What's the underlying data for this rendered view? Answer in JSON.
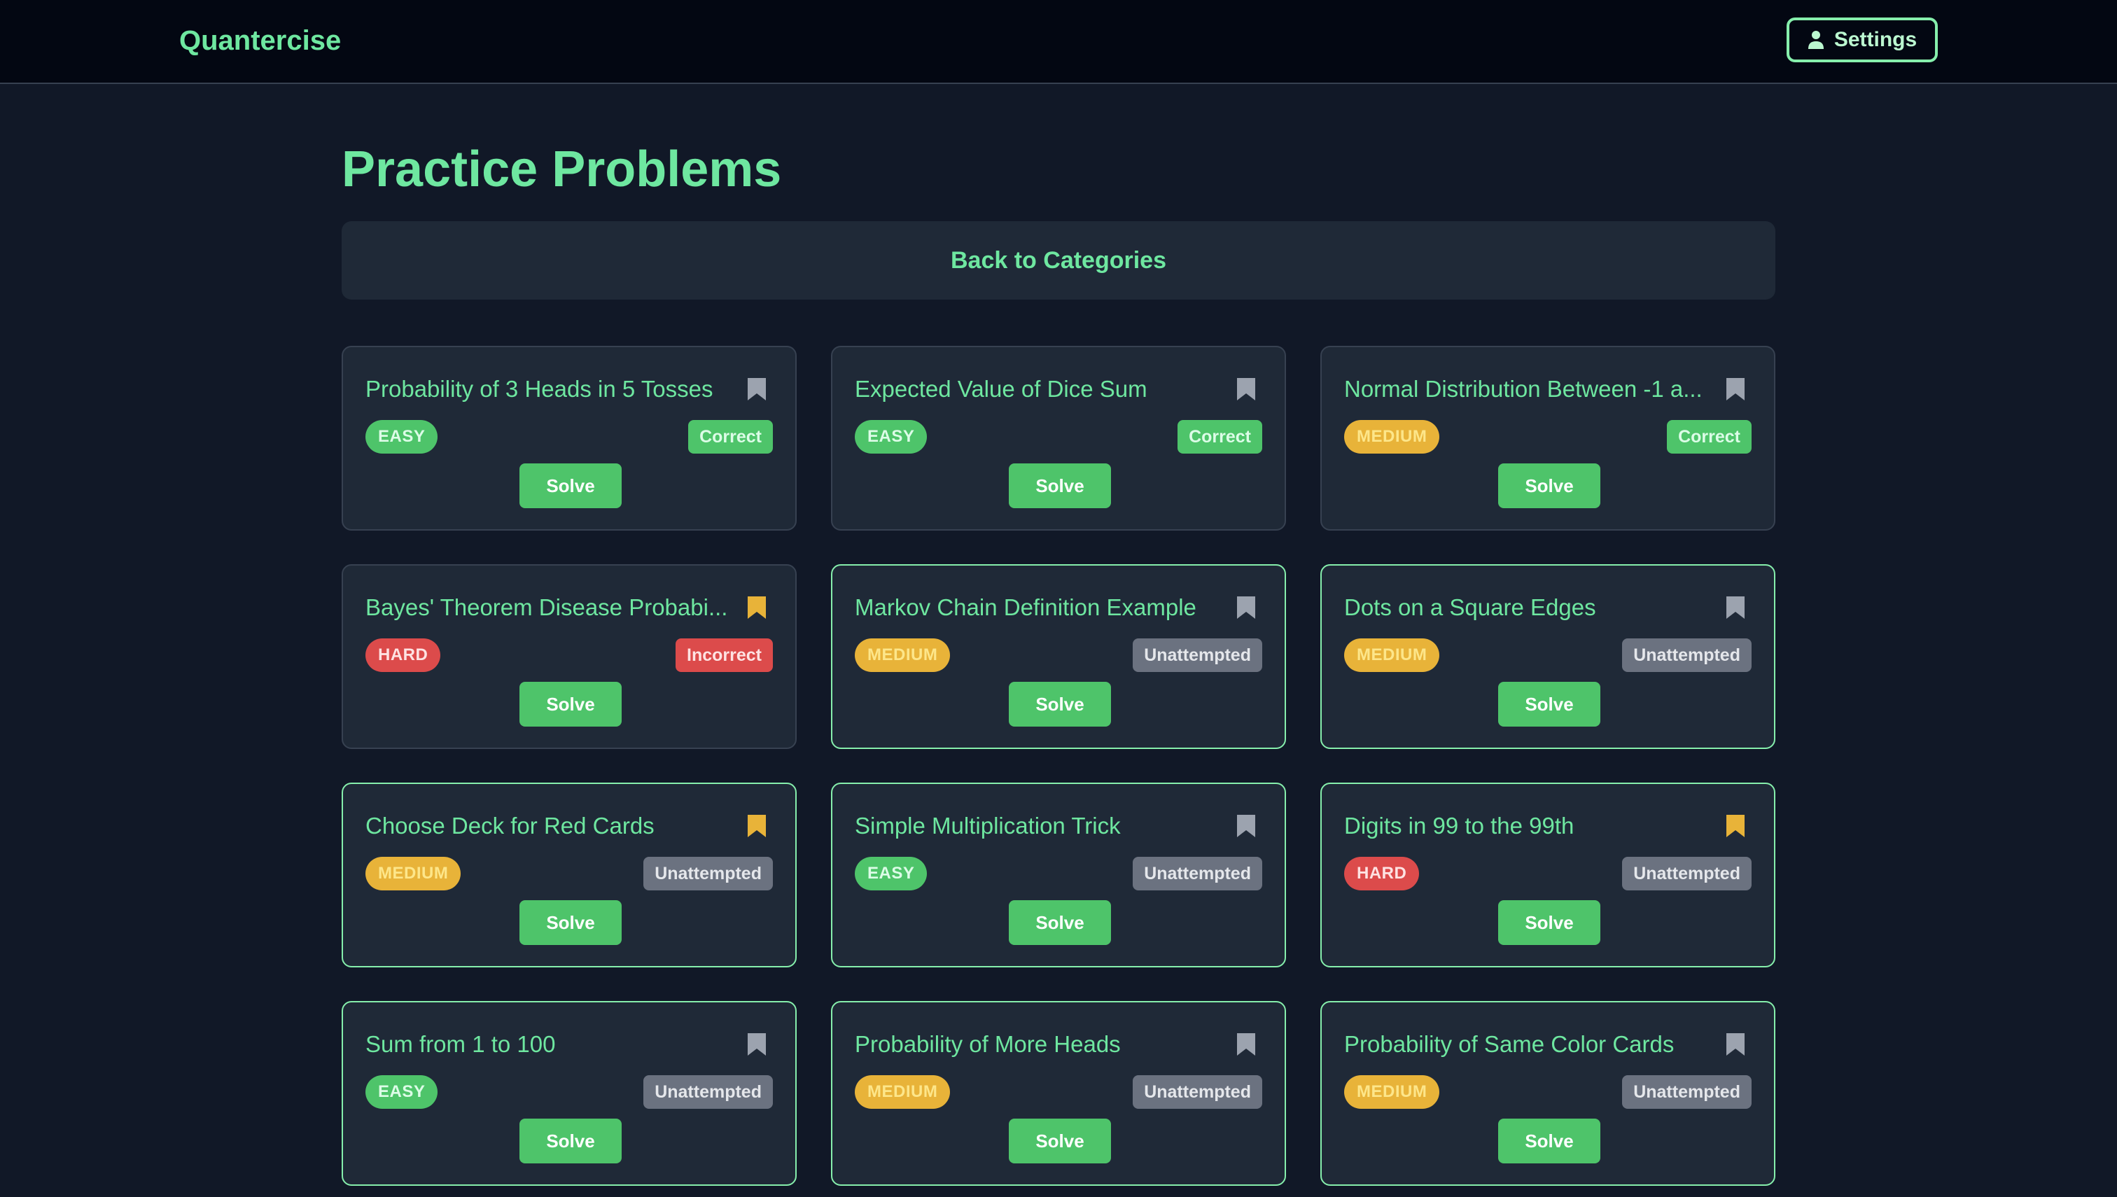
{
  "app": {
    "brand": "Quantercise"
  },
  "header": {
    "settings_label": "Settings",
    "settings_icon": "user-icon"
  },
  "page": {
    "title": "Practice Problems",
    "back_label": "Back to Categories"
  },
  "colors": {
    "easy": "#4ec46a",
    "medium": "#e8b339",
    "hard": "#dc4b4b",
    "correct": "#4ec46a",
    "incorrect": "#dc4b4b",
    "unattempted": "#6b7280",
    "bookmark_on": "#e8b339",
    "bookmark_off": "#9ca3af"
  },
  "problems": [
    {
      "title": "Probability of 3 Heads in 5 Tosses",
      "difficulty": "EASY",
      "status": "Correct",
      "bookmarked": false,
      "solve_label": "Solve"
    },
    {
      "title": "Expected Value of Dice Sum",
      "difficulty": "EASY",
      "status": "Correct",
      "bookmarked": false,
      "solve_label": "Solve"
    },
    {
      "title": "Normal Distribution Between -1 a...",
      "difficulty": "MEDIUM",
      "status": "Correct",
      "bookmarked": false,
      "solve_label": "Solve"
    },
    {
      "title": "Bayes' Theorem Disease Probabi...",
      "difficulty": "HARD",
      "status": "Incorrect",
      "bookmarked": true,
      "solve_label": "Solve"
    },
    {
      "title": "Markov Chain Definition Example",
      "difficulty": "MEDIUM",
      "status": "Unattempted",
      "bookmarked": false,
      "solve_label": "Solve"
    },
    {
      "title": "Dots on a Square Edges",
      "difficulty": "MEDIUM",
      "status": "Unattempted",
      "bookmarked": false,
      "solve_label": "Solve"
    },
    {
      "title": "Choose Deck for Red Cards",
      "difficulty": "MEDIUM",
      "status": "Unattempted",
      "bookmarked": true,
      "solve_label": "Solve"
    },
    {
      "title": "Simple Multiplication Trick",
      "difficulty": "EASY",
      "status": "Unattempted",
      "bookmarked": false,
      "solve_label": "Solve"
    },
    {
      "title": "Digits in 99 to the 99th",
      "difficulty": "HARD",
      "status": "Unattempted",
      "bookmarked": true,
      "solve_label": "Solve"
    },
    {
      "title": "Sum from 1 to 100",
      "difficulty": "EASY",
      "status": "Unattempted",
      "bookmarked": false,
      "solve_label": "Solve"
    },
    {
      "title": "Probability of More Heads",
      "difficulty": "MEDIUM",
      "status": "Unattempted",
      "bookmarked": false,
      "solve_label": "Solve"
    },
    {
      "title": "Probability of Same Color Cards",
      "difficulty": "MEDIUM",
      "status": "Unattempted",
      "bookmarked": false,
      "solve_label": "Solve"
    }
  ]
}
